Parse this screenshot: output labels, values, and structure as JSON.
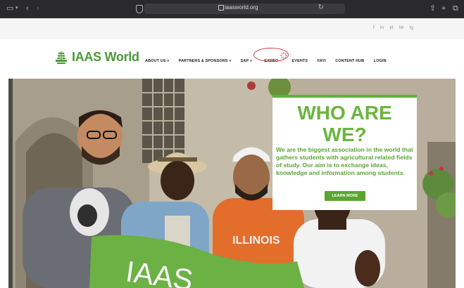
{
  "browser": {
    "url": "iaasworld.org"
  },
  "social": {
    "icons": [
      "f",
      "in",
      "yt",
      "tw",
      "ig"
    ]
  },
  "site": {
    "logo_text": "IAAS World"
  },
  "nav": {
    "items": [
      {
        "label": "ABOUT US",
        "has_dropdown": true
      },
      {
        "label": "PARTNERS & SPONSORS",
        "has_dropdown": true
      },
      {
        "label": "SAP",
        "has_dropdown": true
      },
      {
        "label": "EXPRO",
        "has_dropdown": false
      },
      {
        "label": "EVENTS",
        "has_dropdown": false
      },
      {
        "label": "FAYI",
        "has_dropdown": false
      },
      {
        "label": "CONTENT HUB",
        "has_dropdown": false
      },
      {
        "label": "LOGIN",
        "has_dropdown": false
      }
    ],
    "caret": "▾"
  },
  "hero": {
    "card_title_line1": "WHO ARE",
    "card_title_line2": "WE?",
    "card_body": "We are the biggest association in the world that gathers students with agricultural related fields of study. Our aim is to exchange ideas, knowledge and information among students.",
    "button_label": "LEARN MORE",
    "flag_text": "IAAS",
    "shirt_text": "ILLINOIS"
  },
  "colors": {
    "brand_green": "#5aa532",
    "annotation_red": "#d23a3a"
  }
}
